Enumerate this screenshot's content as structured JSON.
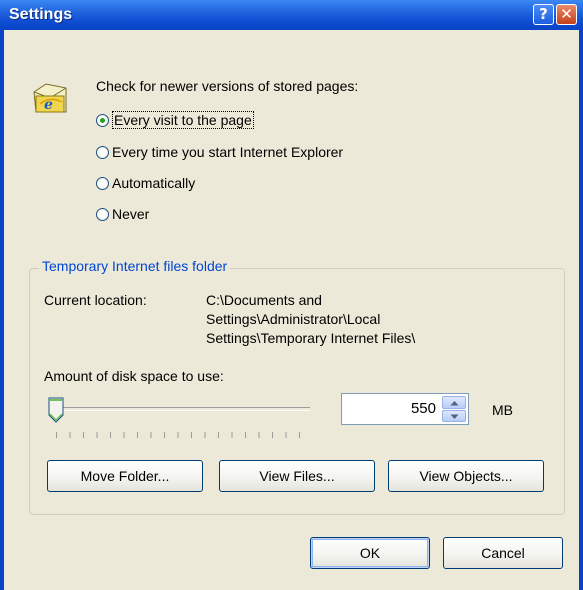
{
  "window": {
    "title": "Settings",
    "help_glyph": "?",
    "close_glyph": "✕"
  },
  "check": {
    "label": "Check for newer versions of stored pages:",
    "options": [
      {
        "label": "Every visit to the page",
        "checked": true
      },
      {
        "label": "Every time you start Internet Explorer",
        "checked": false
      },
      {
        "label": "Automatically",
        "checked": false
      },
      {
        "label": "Never",
        "checked": false
      }
    ]
  },
  "temp_folder": {
    "group_title": "Temporary Internet files folder",
    "location_label": "Current location:",
    "location_lines": [
      "C:\\Documents and",
      "Settings\\Administrator\\Local",
      "Settings\\Temporary Internet Files\\"
    ],
    "disk_space_label": "Amount of disk space to use:",
    "disk_space_value": "550",
    "unit": "MB",
    "slider_level": 0.0,
    "buttons": {
      "move_folder": "Move Folder...",
      "view_files": "View Files...",
      "view_objects": "View Objects..."
    }
  },
  "dialog_buttons": {
    "ok": "OK",
    "cancel": "Cancel"
  },
  "colors": {
    "title_bar": "#0a44c6",
    "face": "#ece9d8",
    "group_title": "#0046d5"
  },
  "icons": {
    "app": "ie-settings-icon",
    "spin_up": "spin-up-icon",
    "spin_down": "spin-down-icon"
  }
}
